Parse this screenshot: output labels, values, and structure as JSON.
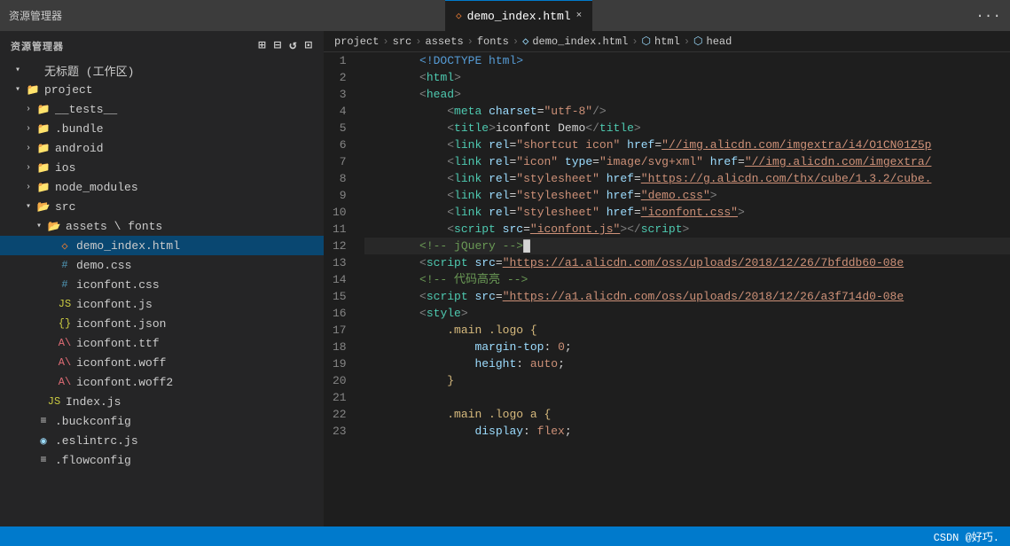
{
  "titlebar": {
    "left": "资源管理器",
    "dots": "···",
    "tab_icon": "◇",
    "tab_label": "demo_index.html",
    "tab_close": "×"
  },
  "breadcrumb": {
    "items": [
      {
        "label": "project",
        "type": "text"
      },
      {
        "label": ">",
        "type": "sep"
      },
      {
        "label": "src",
        "type": "text"
      },
      {
        "label": ">",
        "type": "sep"
      },
      {
        "label": "assets",
        "type": "text"
      },
      {
        "label": ">",
        "type": "sep"
      },
      {
        "label": "fonts",
        "type": "text"
      },
      {
        "label": ">",
        "type": "sep"
      },
      {
        "label": "◇",
        "type": "icon"
      },
      {
        "label": "demo_index.html",
        "type": "text"
      },
      {
        "label": ">",
        "type": "sep"
      },
      {
        "label": "⬡",
        "type": "icon"
      },
      {
        "label": "html",
        "type": "text"
      },
      {
        "label": ">",
        "type": "sep"
      },
      {
        "label": "⬡",
        "type": "icon"
      },
      {
        "label": "head",
        "type": "text"
      }
    ]
  },
  "sidebar": {
    "title": "资源管理器",
    "workspace_label": "无标题 (工作区)",
    "tree": [
      {
        "id": "project",
        "label": "project",
        "level": 1,
        "type": "folder-open",
        "expanded": true
      },
      {
        "id": "tests",
        "label": "__tests__",
        "level": 2,
        "type": "folder",
        "expanded": false
      },
      {
        "id": "bundle",
        "label": ".bundle",
        "level": 2,
        "type": "folder",
        "expanded": false
      },
      {
        "id": "android",
        "label": "android",
        "level": 2,
        "type": "folder",
        "expanded": false
      },
      {
        "id": "ios",
        "label": "ios",
        "level": 2,
        "type": "folder",
        "expanded": false
      },
      {
        "id": "node_modules",
        "label": "node_modules",
        "level": 2,
        "type": "folder",
        "expanded": false
      },
      {
        "id": "src",
        "label": "src",
        "level": 2,
        "type": "folder-open",
        "expanded": true
      },
      {
        "id": "assets",
        "label": "assets \\ fonts",
        "level": 3,
        "type": "folder-open",
        "expanded": true
      },
      {
        "id": "demo_index",
        "label": "demo_index.html",
        "level": 4,
        "type": "html",
        "active": true
      },
      {
        "id": "demo_css",
        "label": "demo.css",
        "level": 4,
        "type": "css"
      },
      {
        "id": "iconfont_css",
        "label": "iconfont.css",
        "level": 4,
        "type": "css"
      },
      {
        "id": "iconfont_js",
        "label": "iconfont.js",
        "level": 4,
        "type": "js"
      },
      {
        "id": "iconfont_json",
        "label": "iconfont.json",
        "level": 4,
        "type": "json"
      },
      {
        "id": "iconfont_ttf",
        "label": "iconfont.ttf",
        "level": 4,
        "type": "ttf"
      },
      {
        "id": "iconfont_woff",
        "label": "iconfont.woff",
        "level": 4,
        "type": "woff"
      },
      {
        "id": "iconfont_woff2",
        "label": "iconfont.woff2",
        "level": 4,
        "type": "woff"
      },
      {
        "id": "index_js",
        "label": "Index.js",
        "level": 3,
        "type": "js"
      },
      {
        "id": "buckconfig",
        "label": ".buckconfig",
        "level": 2,
        "type": "config"
      },
      {
        "id": "eslintrc",
        "label": ".eslintrc.js",
        "level": 2,
        "type": "js"
      },
      {
        "id": "flowconfig",
        "label": ".flowconfig",
        "level": 2,
        "type": "config"
      }
    ]
  },
  "editor": {
    "lines": [
      {
        "num": 1,
        "tokens": [
          {
            "t": "        ",
            "c": ""
          },
          {
            "t": "<!DOCTYPE html>",
            "c": "c-doctype"
          }
        ]
      },
      {
        "num": 2,
        "tokens": [
          {
            "t": "        ",
            "c": ""
          },
          {
            "t": "<",
            "c": "c-lt"
          },
          {
            "t": "html",
            "c": "c-tag"
          },
          {
            "t": ">",
            "c": "c-lt"
          }
        ]
      },
      {
        "num": 3,
        "tokens": [
          {
            "t": "        ",
            "c": ""
          },
          {
            "t": "<",
            "c": "c-lt"
          },
          {
            "t": "head",
            "c": "c-tag"
          },
          {
            "t": ">",
            "c": "c-lt"
          }
        ]
      },
      {
        "num": 4,
        "tokens": [
          {
            "t": "            ",
            "c": ""
          },
          {
            "t": "<",
            "c": "c-lt"
          },
          {
            "t": "meta",
            "c": "c-tag"
          },
          {
            "t": " ",
            "c": ""
          },
          {
            "t": "charset",
            "c": "c-attr"
          },
          {
            "t": "=",
            "c": "c-white"
          },
          {
            "t": "\"utf-8\"",
            "c": "c-string"
          },
          {
            "t": "/>",
            "c": "c-lt"
          }
        ]
      },
      {
        "num": 5,
        "tokens": [
          {
            "t": "            ",
            "c": ""
          },
          {
            "t": "<",
            "c": "c-lt"
          },
          {
            "t": "title",
            "c": "c-tag"
          },
          {
            "t": ">",
            "c": "c-lt"
          },
          {
            "t": "iconfont Demo",
            "c": "c-white"
          },
          {
            "t": "</",
            "c": "c-lt"
          },
          {
            "t": "title",
            "c": "c-tag"
          },
          {
            "t": ">",
            "c": "c-lt"
          }
        ]
      },
      {
        "num": 6,
        "tokens": [
          {
            "t": "            ",
            "c": ""
          },
          {
            "t": "<",
            "c": "c-lt"
          },
          {
            "t": "link",
            "c": "c-tag"
          },
          {
            "t": " ",
            "c": ""
          },
          {
            "t": "rel",
            "c": "c-attr"
          },
          {
            "t": "=",
            "c": "c-white"
          },
          {
            "t": "\"shortcut icon\"",
            "c": "c-string"
          },
          {
            "t": " ",
            "c": ""
          },
          {
            "t": "href",
            "c": "c-attr"
          },
          {
            "t": "=",
            "c": "c-white"
          },
          {
            "t": "\"//img.alicdn.com/imgextra/i4/O1CN01Z5p",
            "c": "c-link"
          }
        ]
      },
      {
        "num": 7,
        "tokens": [
          {
            "t": "            ",
            "c": ""
          },
          {
            "t": "<",
            "c": "c-lt"
          },
          {
            "t": "link",
            "c": "c-tag"
          },
          {
            "t": " ",
            "c": ""
          },
          {
            "t": "rel",
            "c": "c-attr"
          },
          {
            "t": "=",
            "c": "c-white"
          },
          {
            "t": "\"icon\"",
            "c": "c-string"
          },
          {
            "t": " ",
            "c": ""
          },
          {
            "t": "type",
            "c": "c-attr"
          },
          {
            "t": "=",
            "c": "c-white"
          },
          {
            "t": "\"image/svg+xml\"",
            "c": "c-string"
          },
          {
            "t": " ",
            "c": ""
          },
          {
            "t": "href",
            "c": "c-attr"
          },
          {
            "t": "=",
            "c": "c-white"
          },
          {
            "t": "\"//img.alicdn.com/imgextra/",
            "c": "c-link"
          }
        ]
      },
      {
        "num": 8,
        "tokens": [
          {
            "t": "            ",
            "c": ""
          },
          {
            "t": "<",
            "c": "c-lt"
          },
          {
            "t": "link",
            "c": "c-tag"
          },
          {
            "t": " ",
            "c": ""
          },
          {
            "t": "rel",
            "c": "c-attr"
          },
          {
            "t": "=",
            "c": "c-white"
          },
          {
            "t": "\"stylesheet\"",
            "c": "c-string"
          },
          {
            "t": " ",
            "c": ""
          },
          {
            "t": "href",
            "c": "c-attr"
          },
          {
            "t": "=",
            "c": "c-white"
          },
          {
            "t": "\"https://g.alicdn.com/thx/cube/1.3.2/cube.",
            "c": "c-link"
          }
        ]
      },
      {
        "num": 9,
        "tokens": [
          {
            "t": "            ",
            "c": ""
          },
          {
            "t": "<",
            "c": "c-lt"
          },
          {
            "t": "link",
            "c": "c-tag"
          },
          {
            "t": " ",
            "c": ""
          },
          {
            "t": "rel",
            "c": "c-attr"
          },
          {
            "t": "=",
            "c": "c-white"
          },
          {
            "t": "\"stylesheet\"",
            "c": "c-string"
          },
          {
            "t": " ",
            "c": ""
          },
          {
            "t": "href",
            "c": "c-attr"
          },
          {
            "t": "=",
            "c": "c-white"
          },
          {
            "t": "\"demo.css\"",
            "c": "c-link"
          },
          {
            "t": ">",
            "c": "c-lt"
          }
        ]
      },
      {
        "num": 10,
        "tokens": [
          {
            "t": "            ",
            "c": ""
          },
          {
            "t": "<",
            "c": "c-lt"
          },
          {
            "t": "link",
            "c": "c-tag"
          },
          {
            "t": " ",
            "c": ""
          },
          {
            "t": "rel",
            "c": "c-attr"
          },
          {
            "t": "=",
            "c": "c-white"
          },
          {
            "t": "\"stylesheet\"",
            "c": "c-string"
          },
          {
            "t": " ",
            "c": ""
          },
          {
            "t": "href",
            "c": "c-attr"
          },
          {
            "t": "=",
            "c": "c-white"
          },
          {
            "t": "\"iconfont.css\"",
            "c": "c-link"
          },
          {
            "t": ">",
            "c": "c-lt"
          }
        ]
      },
      {
        "num": 11,
        "tokens": [
          {
            "t": "            ",
            "c": ""
          },
          {
            "t": "<",
            "c": "c-lt"
          },
          {
            "t": "script",
            "c": "c-tag"
          },
          {
            "t": " ",
            "c": ""
          },
          {
            "t": "src",
            "c": "c-attr"
          },
          {
            "t": "=",
            "c": "c-white"
          },
          {
            "t": "\"iconfont.js\"",
            "c": "c-link"
          },
          {
            "t": "></",
            "c": "c-lt"
          },
          {
            "t": "script",
            "c": "c-tag"
          },
          {
            "t": ">",
            "c": "c-lt"
          }
        ]
      },
      {
        "num": 12,
        "tokens": [
          {
            "t": "        ",
            "c": ""
          },
          {
            "t": "<!-- jQuery -->",
            "c": "c-comment"
          },
          {
            "t": "█",
            "c": "c-white"
          }
        ],
        "active": true
      },
      {
        "num": 13,
        "tokens": [
          {
            "t": "        ",
            "c": ""
          },
          {
            "t": "<",
            "c": "c-lt"
          },
          {
            "t": "script",
            "c": "c-tag"
          },
          {
            "t": " ",
            "c": ""
          },
          {
            "t": "src",
            "c": "c-attr"
          },
          {
            "t": "=",
            "c": "c-white"
          },
          {
            "t": "\"https://a1.alicdn.com/oss/uploads/2018/12/26/7bfddb60-08e",
            "c": "c-link"
          }
        ]
      },
      {
        "num": 14,
        "tokens": [
          {
            "t": "        ",
            "c": ""
          },
          {
            "t": "<!-- 代码高亮 -->",
            "c": "c-comment"
          }
        ]
      },
      {
        "num": 15,
        "tokens": [
          {
            "t": "        ",
            "c": ""
          },
          {
            "t": "<",
            "c": "c-lt"
          },
          {
            "t": "script",
            "c": "c-tag"
          },
          {
            "t": " ",
            "c": ""
          },
          {
            "t": "src",
            "c": "c-attr"
          },
          {
            "t": "=",
            "c": "c-white"
          },
          {
            "t": "\"https://a1.alicdn.com/oss/uploads/2018/12/26/a3f714d0-08e",
            "c": "c-link"
          }
        ]
      },
      {
        "num": 16,
        "tokens": [
          {
            "t": "        ",
            "c": ""
          },
          {
            "t": "<",
            "c": "c-lt"
          },
          {
            "t": "style",
            "c": "c-tag"
          },
          {
            "t": ">",
            "c": "c-lt"
          }
        ]
      },
      {
        "num": 17,
        "tokens": [
          {
            "t": "            ",
            "c": ""
          },
          {
            "t": ".main .logo {",
            "c": "c-selector"
          }
        ]
      },
      {
        "num": 18,
        "tokens": [
          {
            "t": "                ",
            "c": ""
          },
          {
            "t": "margin-top",
            "c": "c-property"
          },
          {
            "t": ": ",
            "c": "c-white"
          },
          {
            "t": "0",
            "c": "c-value"
          },
          {
            "t": ";",
            "c": "c-white"
          }
        ]
      },
      {
        "num": 19,
        "tokens": [
          {
            "t": "                ",
            "c": ""
          },
          {
            "t": "height",
            "c": "c-property"
          },
          {
            "t": ": ",
            "c": "c-white"
          },
          {
            "t": "auto",
            "c": "c-value"
          },
          {
            "t": ";",
            "c": "c-white"
          }
        ]
      },
      {
        "num": 20,
        "tokens": [
          {
            "t": "            ",
            "c": ""
          },
          {
            "t": "}",
            "c": "c-selector"
          }
        ]
      },
      {
        "num": 21,
        "tokens": []
      },
      {
        "num": 22,
        "tokens": [
          {
            "t": "            ",
            "c": ""
          },
          {
            "t": ".main .logo a {",
            "c": "c-selector"
          }
        ]
      },
      {
        "num": 23,
        "tokens": [
          {
            "t": "                ",
            "c": ""
          },
          {
            "t": "display",
            "c": "c-property"
          },
          {
            "t": ": ",
            "c": "c-white"
          },
          {
            "t": "flex",
            "c": "c-value"
          },
          {
            "t": ";",
            "c": "c-white"
          }
        ]
      }
    ]
  },
  "statusbar": {
    "watermark": "CSDN @好巧."
  }
}
